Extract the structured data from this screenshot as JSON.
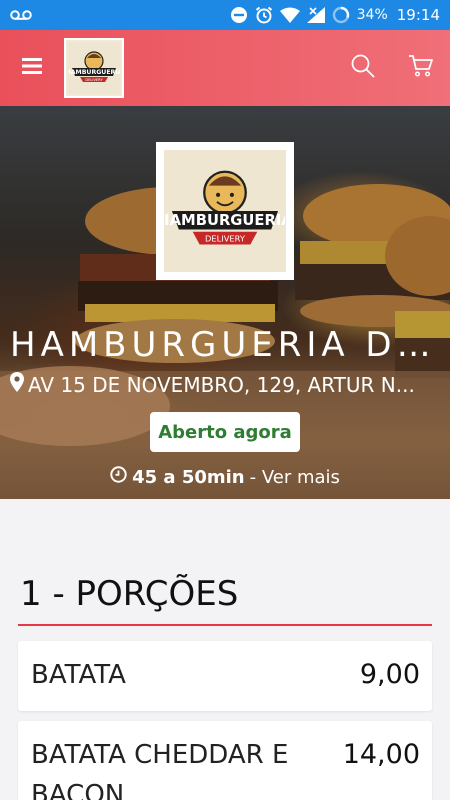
{
  "status_bar": {
    "battery": "34%",
    "time": "19:14",
    "bar_color": "#1e88e5"
  },
  "app_bar": {
    "color": "#e9505a",
    "icons": [
      "menu-icon",
      "search-icon",
      "cart-icon"
    ]
  },
  "restaurant": {
    "name": "HAMBURGUERIA DE...",
    "address": "AV 15 DE NOVEMBRO, 129, ARTUR N...",
    "status": "Aberto agora",
    "delivery_time": "45 a 50min",
    "see_more": "- Ver mais",
    "logo_text": "HAMBURGUERIA",
    "logo_subtext": "DELIVERY"
  },
  "menu": {
    "section_title": "1 - PORÇÕES",
    "items": [
      {
        "name": "BATATA",
        "price": "9,00"
      },
      {
        "name": "BATATA CHEDDAR E BACON",
        "price": "14,00"
      }
    ]
  },
  "colors": {
    "accent": "#e53945",
    "open_green": "#2e7d32"
  }
}
